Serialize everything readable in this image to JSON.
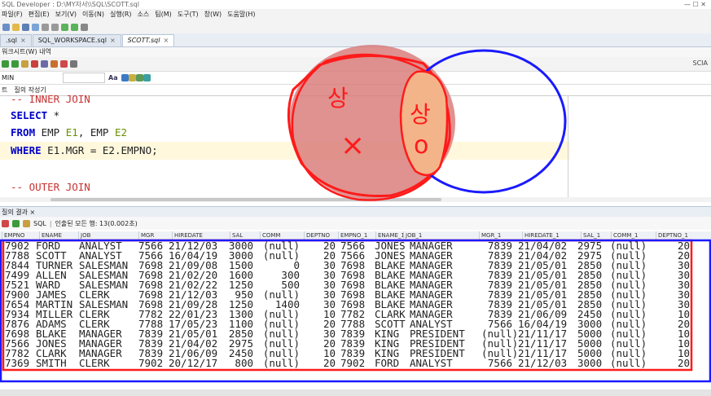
{
  "window": {
    "title": "SQL Developer : D:\\MY자서\\\\SQL\\SCOTT.sql",
    "controls": "—  ☐  ✕"
  },
  "menu": [
    "파일(F)",
    "편집(E)",
    "보기(V)",
    "이동(N)",
    "실행(R)",
    "소스",
    "팀(M)",
    "도구(T)",
    "창(W)",
    "도움말(H)"
  ],
  "doc_tabs": [
    {
      "label": ".sql",
      "active": false
    },
    {
      "label": "SQL_WORKSPACE.sql",
      "active": false
    },
    {
      "label": "SCOTT.sql",
      "active": true
    }
  ],
  "sub_tabs": "워크시트(W)  내역",
  "connection": {
    "left": "MIN",
    "right": "SCIA"
  },
  "toolbar3": {
    "aa": "Aa"
  },
  "editor_tabs": [
    "트",
    "질의 작성기"
  ],
  "editor": {
    "lines": [
      [
        {
          "t": "-- INNER JOIN",
          "c": "cm"
        }
      ],
      [
        {
          "t": "SELECT",
          "c": "kw"
        },
        {
          "t": " *",
          "c": ""
        }
      ],
      [
        {
          "t": "FROM",
          "c": "kw"
        },
        {
          "t": " EMP ",
          "c": ""
        },
        {
          "t": "E1",
          "c": "al"
        },
        {
          "t": ", EMP ",
          "c": ""
        },
        {
          "t": "E2",
          "c": "al"
        }
      ],
      [
        {
          "t": "WHERE",
          "c": "kw"
        },
        {
          "t": " E1.MGR = E2.EMPNO;",
          "c": ""
        }
      ],
      [
        {
          "t": "",
          "c": ""
        }
      ],
      [
        {
          "t": "-- OUTER JOIN",
          "c": "cm"
        }
      ]
    ]
  },
  "results": {
    "tab_label": "질의 결과 ×",
    "toolbar_sql": "SQL",
    "status": "인출된 모든 행: 13(0.002초)",
    "columns": [
      "EMPNO",
      "ENAME",
      "JOB",
      "MGR",
      "HIREDATE",
      "SAL",
      "COMM",
      "DEPTNO",
      "EMPNO_1",
      "ENAME_1",
      "JOB_1",
      "MGR_1",
      "HIREDATE_1",
      "SAL_1",
      "COMM_1",
      "DEPTNO_1"
    ],
    "rows": [
      [
        "7902",
        "FORD",
        "ANALYST",
        "7566",
        "21/12/03",
        "3000",
        "(null)",
        "20",
        "7566",
        "JONES",
        "MANAGER",
        "7839",
        "21/04/02",
        "2975",
        "(null)",
        "20"
      ],
      [
        "7788",
        "SCOTT",
        "ANALYST",
        "7566",
        "16/04/19",
        "3000",
        "(null)",
        "20",
        "7566",
        "JONES",
        "MANAGER",
        "7839",
        "21/04/02",
        "2975",
        "(null)",
        "20"
      ],
      [
        "7844",
        "TURNER",
        "SALESMAN",
        "7698",
        "21/09/08",
        "1500",
        "0",
        "30",
        "7698",
        "BLAKE",
        "MANAGER",
        "7839",
        "21/05/01",
        "2850",
        "(null)",
        "30"
      ],
      [
        "7499",
        "ALLEN",
        "SALESMAN",
        "7698",
        "21/02/20",
        "1600",
        "300",
        "30",
        "7698",
        "BLAKE",
        "MANAGER",
        "7839",
        "21/05/01",
        "2850",
        "(null)",
        "30"
      ],
      [
        "7521",
        "WARD",
        "SALESMAN",
        "7698",
        "21/02/22",
        "1250",
        "500",
        "30",
        "7698",
        "BLAKE",
        "MANAGER",
        "7839",
        "21/05/01",
        "2850",
        "(null)",
        "30"
      ],
      [
        "7900",
        "JAMES",
        "CLERK",
        "7698",
        "21/12/03",
        "950",
        "(null)",
        "30",
        "7698",
        "BLAKE",
        "MANAGER",
        "7839",
        "21/05/01",
        "2850",
        "(null)",
        "30"
      ],
      [
        "7654",
        "MARTIN",
        "SALESMAN",
        "7698",
        "21/09/28",
        "1250",
        "1400",
        "30",
        "7698",
        "BLAKE",
        "MANAGER",
        "7839",
        "21/05/01",
        "2850",
        "(null)",
        "30"
      ],
      [
        "7934",
        "MILLER",
        "CLERK",
        "7782",
        "22/01/23",
        "1300",
        "(null)",
        "10",
        "7782",
        "CLARK",
        "MANAGER",
        "7839",
        "21/06/09",
        "2450",
        "(null)",
        "10"
      ],
      [
        "7876",
        "ADAMS",
        "CLERK",
        "7788",
        "17/05/23",
        "1100",
        "(null)",
        "20",
        "7788",
        "SCOTT",
        "ANALYST",
        "7566",
        "16/04/19",
        "3000",
        "(null)",
        "20"
      ],
      [
        "7698",
        "BLAKE",
        "MANAGER",
        "7839",
        "21/05/01",
        "2850",
        "(null)",
        "30",
        "7839",
        "KING",
        "PRESIDENT",
        "(null)",
        "21/11/17",
        "5000",
        "(null)",
        "10"
      ],
      [
        "7566",
        "JONES",
        "MANAGER",
        "7839",
        "21/04/02",
        "2975",
        "(null)",
        "20",
        "7839",
        "KING",
        "PRESIDENT",
        "(null)",
        "21/11/17",
        "5000",
        "(null)",
        "10"
      ],
      [
        "7782",
        "CLARK",
        "MANAGER",
        "7839",
        "21/06/09",
        "2450",
        "(null)",
        "10",
        "7839",
        "KING",
        "PRESIDENT",
        "(null)",
        "21/11/17",
        "5000",
        "(null)",
        "10"
      ],
      [
        "7369",
        "SMITH",
        "CLERK",
        "7902",
        "20/12/17",
        "800",
        "(null)",
        "20",
        "7902",
        "FORD",
        "ANALYST",
        "7566",
        "21/12/03",
        "3000",
        "(null)",
        "20"
      ]
    ]
  },
  "annotation": {
    "left_text": "상",
    "left_mark": "×",
    "right_text": "상",
    "right_mark": "o",
    "red": "#ff1a1a",
    "blue": "#1a1aff",
    "fill_red": "#d87a78",
    "fill_orange": "#f4b48a"
  }
}
